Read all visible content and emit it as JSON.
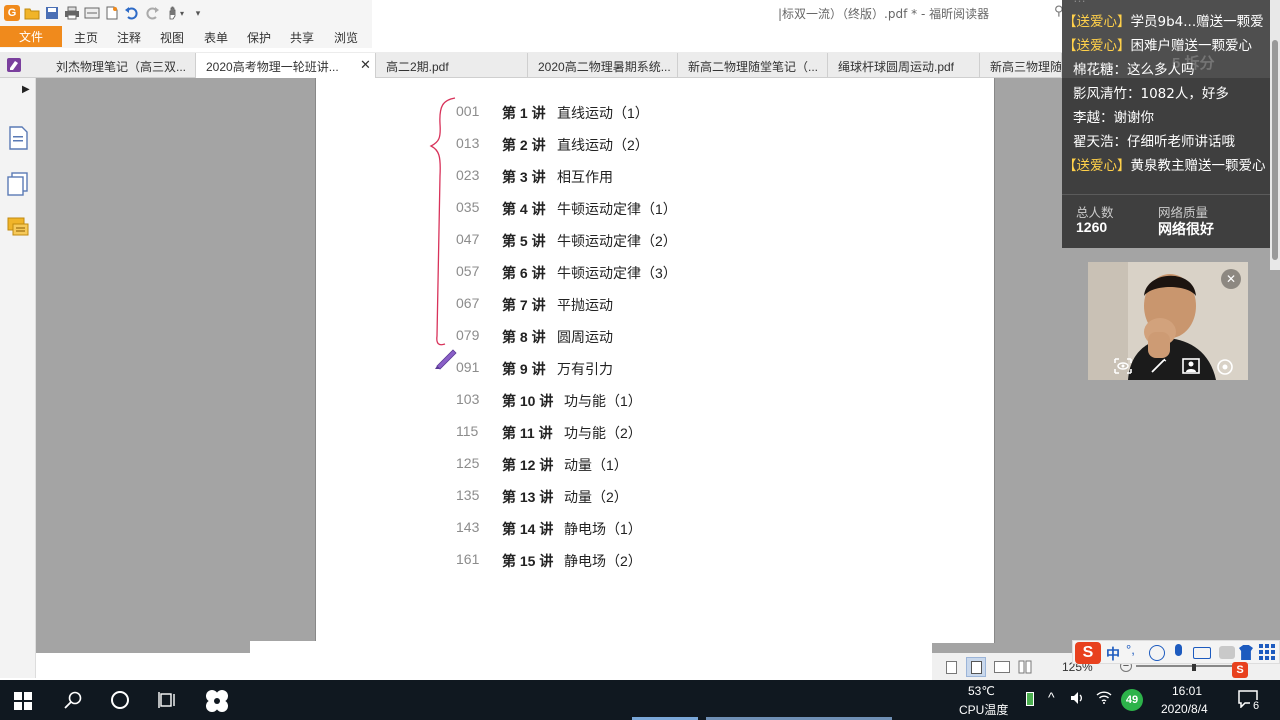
{
  "window": {
    "title": "|标双一流）（终版）.pdf * - 福昕阅读器"
  },
  "menu": {
    "file": "文件",
    "items": [
      "主页",
      "注释",
      "视图",
      "表单",
      "保护",
      "共享",
      "浏览"
    ]
  },
  "tabs": [
    {
      "label": "刘杰物理笔记（高三双...",
      "active": false
    },
    {
      "label": "2020高考物理一轮班讲...",
      "active": true
    },
    {
      "label": "高二2期.pdf",
      "active": false
    },
    {
      "label": "2020高二物理暑期系统...",
      "active": false
    },
    {
      "label": "新高二物理随堂笔记（...",
      "active": false
    },
    {
      "label": "绳球杆球圆周运动.pdf",
      "active": false
    },
    {
      "label": "新高三物理随",
      "active": false
    }
  ],
  "toc": [
    {
      "page": "001",
      "lecture": "第 1 讲",
      "title": "直线运动（1）"
    },
    {
      "page": "013",
      "lecture": "第 2 讲",
      "title": "直线运动（2）"
    },
    {
      "page": "023",
      "lecture": "第 3 讲",
      "title": "相互作用"
    },
    {
      "page": "035",
      "lecture": "第 4 讲",
      "title": "牛顿运动定律（1）"
    },
    {
      "page": "047",
      "lecture": "第 5 讲",
      "title": "牛顿运动定律（2）"
    },
    {
      "page": "057",
      "lecture": "第 6 讲",
      "title": "牛顿运动定律（3）"
    },
    {
      "page": "067",
      "lecture": "第 7 讲",
      "title": "平抛运动"
    },
    {
      "page": "079",
      "lecture": "第 8 讲",
      "title": "圆周运动"
    },
    {
      "page": "091",
      "lecture": "第 9 讲",
      "title": "万有引力"
    },
    {
      "page": "103",
      "lecture": "第 10 讲",
      "title": "功与能（1）"
    },
    {
      "page": "115",
      "lecture": "第 11 讲",
      "title": "功与能（2）"
    },
    {
      "page": "125",
      "lecture": "第 12 讲",
      "title": "动量（1）"
    },
    {
      "page": "135",
      "lecture": "第 13 讲",
      "title": "动量（2）"
    },
    {
      "page": "143",
      "lecture": "第 14 讲",
      "title": "静电场（1）"
    },
    {
      "page": "161",
      "lecture": "第 15 讲",
      "title": "静电场（2）"
    }
  ],
  "chat": {
    "messages": [
      {
        "gift": "【送爱心】",
        "text": "学员9b4...赠送一颗爱"
      },
      {
        "gift": "【送爱心】",
        "text": "困难户赠送一颗爱心"
      },
      {
        "gift": "",
        "text": "棉花糖：这么多人吗"
      },
      {
        "gift": "",
        "text": "影风清竹：1082人，好多"
      },
      {
        "gift": "",
        "text": "李越：谢谢你"
      },
      {
        "gift": "",
        "text": "翟天浩：仔细听老师讲话哦"
      },
      {
        "gift": "【送爱心】",
        "text": "黄泉教主赠送一颗爱心"
      }
    ],
    "stats": {
      "total_label": "总人数",
      "total_value": "1260",
      "network_label": "网络质量",
      "network_value": "网络很好"
    },
    "watermark": "5 拆分"
  },
  "zoom": "125%",
  "ime": {
    "mode": "中",
    "punct": "°,"
  },
  "taskbar": {
    "temp": "53℃",
    "temp_label": "CPU温度",
    "badge": "49",
    "time": "16:01",
    "date": "2020/8/4",
    "notif_count": "6"
  }
}
